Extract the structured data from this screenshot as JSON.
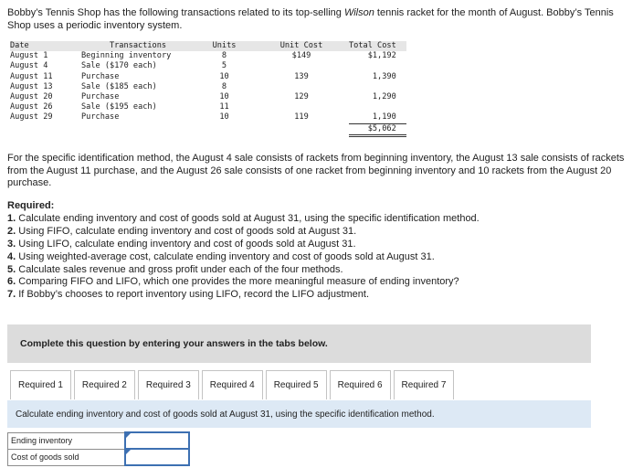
{
  "intro": {
    "part1": "Bobby’s Tennis Shop has the following transactions related to its top-selling ",
    "brand": "Wilson",
    "part2": " tennis racket for the month of August. Bobby’s Tennis Shop uses a periodic inventory system."
  },
  "table": {
    "headers": [
      "Date",
      "Transactions",
      "Units",
      "Unit Cost",
      "Total Cost"
    ],
    "rows": [
      {
        "date": "August 1",
        "transaction": "Beginning inventory",
        "units": "8",
        "unit_cost": "$149",
        "total_cost": "$1,192"
      },
      {
        "date": "August 4",
        "transaction": "Sale ($170 each)",
        "units": "5",
        "unit_cost": "",
        "total_cost": ""
      },
      {
        "date": "August 11",
        "transaction": "Purchase",
        "units": "10",
        "unit_cost": "139",
        "total_cost": "1,390"
      },
      {
        "date": "August 13",
        "transaction": "Sale ($185 each)",
        "units": "8",
        "unit_cost": "",
        "total_cost": ""
      },
      {
        "date": "August 20",
        "transaction": "Purchase",
        "units": "10",
        "unit_cost": "129",
        "total_cost": "1,290"
      },
      {
        "date": "August 26",
        "transaction": "Sale ($195 each)",
        "units": "11",
        "unit_cost": "",
        "total_cost": ""
      },
      {
        "date": "August 29",
        "transaction": "Purchase",
        "units": "10",
        "unit_cost": "119",
        "total_cost": "1,190"
      }
    ],
    "grand_total": "$5,062"
  },
  "specific_id_paragraph": "For the specific identification method, the August 4 sale consists of rackets from beginning inventory, the August 13 sale consists of rackets from the August 11 purchase, and the August 26 sale consists of one racket from beginning inventory and 10 rackets from the August 20 purchase.",
  "required": {
    "title": "Required:",
    "items": [
      {
        "num": "1.",
        "text": " Calculate ending inventory and cost of goods sold at August 31, using the specific identification method."
      },
      {
        "num": "2.",
        "text": " Using FIFO, calculate ending inventory and cost of goods sold at August 31."
      },
      {
        "num": "3.",
        "text": " Using LIFO, calculate ending inventory and cost of goods sold at August 31."
      },
      {
        "num": "4.",
        "text": " Using weighted-average cost, calculate ending inventory and cost of goods sold at August 31."
      },
      {
        "num": "5.",
        "text": " Calculate sales revenue and gross profit under each of the four methods."
      },
      {
        "num": "6.",
        "text": " Comparing FIFO and LIFO, which one provides the more meaningful measure of ending inventory?"
      },
      {
        "num": "7.",
        "text": " If Bobby’s chooses to report inventory using LIFO, record the LIFO adjustment."
      }
    ]
  },
  "complete_prompt": "Complete this question by entering your answers in the tabs below.",
  "tabs": [
    "Required 1",
    "Required 2",
    "Required 3",
    "Required 4",
    "Required 5",
    "Required 6",
    "Required 7"
  ],
  "panel_instruction": "Calculate ending inventory and cost of goods sold at August 31, using the specific identification method.",
  "answer_rows": [
    {
      "label": "Ending inventory",
      "value": ""
    },
    {
      "label": "Cost of goods sold",
      "value": ""
    }
  ],
  "colors": {
    "panel_bg": "#dde9f5",
    "input_border": "#3d70b2",
    "gray_box": "#dcdcdc"
  }
}
